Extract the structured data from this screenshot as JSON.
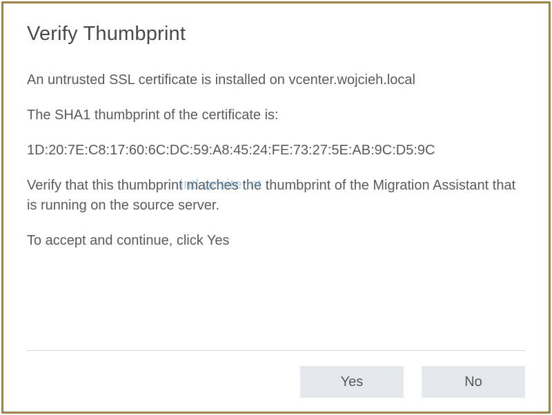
{
  "dialog": {
    "title": "Verify Thumbprint",
    "warning_line": "An untrusted SSL certificate is installed on vcenter.wojcieh.local",
    "sha1_intro": "The SHA1 thumbprint of the certificate is:",
    "sha1_value": "1D:20:7E:C8:17:60:6C:DC:59:A8:45:24:FE:73:27:5E:AB:9C:D5:9C",
    "verify_instruction": "Verify that this thumbprint matches the thumbprint of the Migration Assistant that is running on the source server.",
    "accept_line": "To accept and continue, click Yes",
    "watermark_text": "intl.onsite.int"
  },
  "buttons": {
    "yes": "Yes",
    "no": "No"
  }
}
